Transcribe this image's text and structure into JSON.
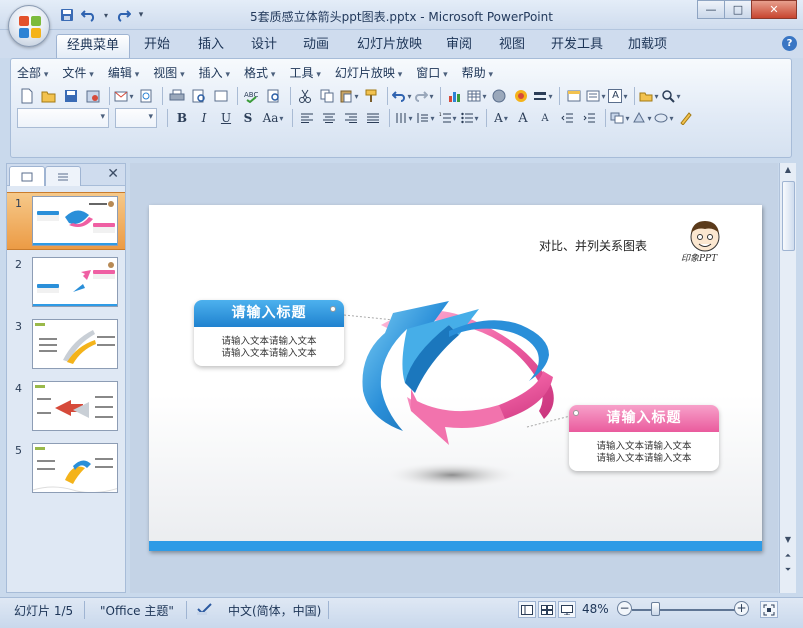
{
  "window": {
    "title": "5套质感立体箭头ppt图表.pptx - Microsoft PowerPoint",
    "minimize": "—",
    "restore": "□",
    "close": "✕"
  },
  "tabs": [
    {
      "label": "经典菜单",
      "active": true
    },
    {
      "label": "开始"
    },
    {
      "label": "插入"
    },
    {
      "label": "设计"
    },
    {
      "label": "动画"
    },
    {
      "label": "幻灯片放映"
    },
    {
      "label": "审阅"
    },
    {
      "label": "视图"
    },
    {
      "label": "开发工具"
    },
    {
      "label": "加载项"
    }
  ],
  "help": "?",
  "menu": [
    "全部",
    "文件",
    "编辑",
    "视图",
    "插入",
    "格式",
    "工具",
    "幻灯片放映",
    "窗口",
    "帮助"
  ],
  "format": {
    "bold": "B",
    "italic": "I",
    "underline": "U",
    "shadow": "S",
    "case": "Aa"
  },
  "font_size_buttons": {
    "grow": "A",
    "shrink": "A"
  },
  "text_box_label": "A",
  "slides": [
    {
      "number": "1",
      "selected": true
    },
    {
      "number": "2"
    },
    {
      "number": "3"
    },
    {
      "number": "4"
    },
    {
      "number": "5"
    }
  ],
  "pane_close": "✕",
  "slide": {
    "title": "对比、并列关系图表",
    "mascot_caption": "印象PPT",
    "box_left": {
      "heading": "请输入标题",
      "line1": "请输入文本请输入文本",
      "line2": "请输入文本请输入文本",
      "color": "#2a8fd9"
    },
    "box_right": {
      "heading": "请输入标题",
      "line1": "请输入文本请输入文本",
      "line2": "请输入文本请输入文本",
      "color": "#ef5fa3"
    }
  },
  "status": {
    "slide": "幻灯片 1/5",
    "theme": "\"Office 主题\"",
    "language": "中文(简体，中国)",
    "zoom": "48%",
    "zoom_out": "−",
    "zoom_in": "+"
  },
  "colors": {
    "accent_blue": "#2e9be6",
    "accent_pink": "#ef5fa3",
    "ribbon": "#dfe8f4"
  }
}
